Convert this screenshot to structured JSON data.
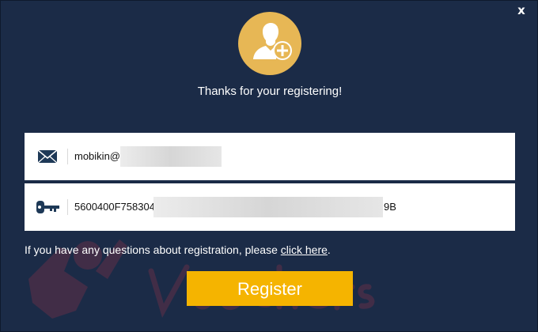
{
  "dialog": {
    "close_label": "x",
    "headline": "Thanks for your registering!",
    "avatar_icon": "user-add-icon",
    "email": {
      "icon": "envelope-icon",
      "value": "mobikin@"
    },
    "code": {
      "icon": "key-icon",
      "prefix": "5600400F758304",
      "suffix": "9B"
    },
    "notice": {
      "text": "If you have any questions about registration, please ",
      "link_label": "click here",
      "end": "."
    },
    "register_label": "Register",
    "watermark_text": "Vouchers",
    "colors": {
      "background": "#1b2b47",
      "accent": "#f5b400",
      "avatar": "#e7b755",
      "icon": "#1e3957"
    }
  }
}
